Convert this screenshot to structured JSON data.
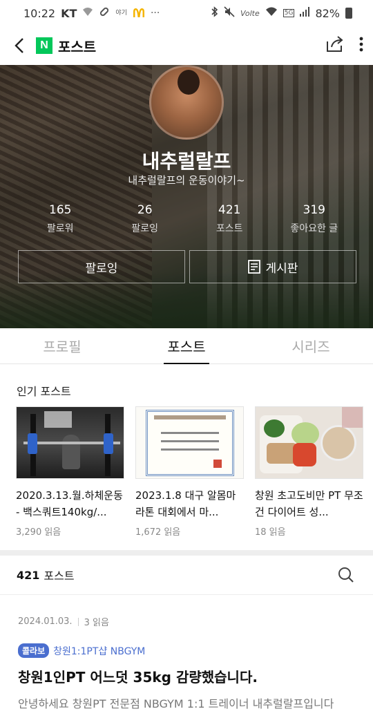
{
  "status_bar": {
    "time": "10:22",
    "carrier": "KT",
    "battery": "82%",
    "icons": [
      "wifi-question-icon",
      "pill-icon",
      "mcdonalds-icon",
      "more-dots-icon",
      "bluetooth-icon",
      "mute-icon",
      "volte-icon",
      "wifi-icon",
      "5g-icon",
      "signal-icon",
      "battery-icon"
    ],
    "small_app_label": "야기",
    "volte_label": "Volte",
    "network_label": "5G",
    "ellipsis": "···"
  },
  "app_bar": {
    "logo_letter": "N",
    "title": "포스트"
  },
  "profile": {
    "name": "내추럴랄프",
    "description": "내추럴랄프의 운동이야기~",
    "stats": [
      {
        "value": "165",
        "label": "팔로워"
      },
      {
        "value": "26",
        "label": "팔로잉"
      },
      {
        "value": "421",
        "label": "포스트"
      },
      {
        "value": "319",
        "label": "좋아요한 글"
      }
    ],
    "follow_button": "팔로잉",
    "board_button": "게시판"
  },
  "tabs": [
    {
      "label": "프로필",
      "active": false
    },
    {
      "label": "포스트",
      "active": true
    },
    {
      "label": "시리즈",
      "active": false
    }
  ],
  "popular": {
    "title": "인기 포스트",
    "items": [
      {
        "title": "2020.3.13.월.하체운동 - 백스쿼트140kg/...",
        "reads": "3,290 읽음"
      },
      {
        "title": "2023.1.8 대구 알몸마라톤 대회에서 마...",
        "reads": "1,672 읽음"
      },
      {
        "title": "창원 초고도비만 PT 무조건 다이어트 성...",
        "reads": "18 읽음"
      }
    ]
  },
  "post_list": {
    "count": "421",
    "count_label": "포스트"
  },
  "post": {
    "date": "2024.01.03.",
    "reads": "3 읽음",
    "collab_badge": "콜라보",
    "collab_name": "창원1:1PT샵 NBGYM",
    "title": "창원1인PT 어느덧 35kg 감량했습니다.",
    "excerpt": "안녕하세요 창원PT 전문점 NBGYM 1:1 트레이너 내추럴랄프입니다"
  },
  "colors": {
    "naver_green": "#03c75a",
    "collab_blue": "#4a6ecf",
    "mcdonalds_yellow": "#f5b400"
  }
}
